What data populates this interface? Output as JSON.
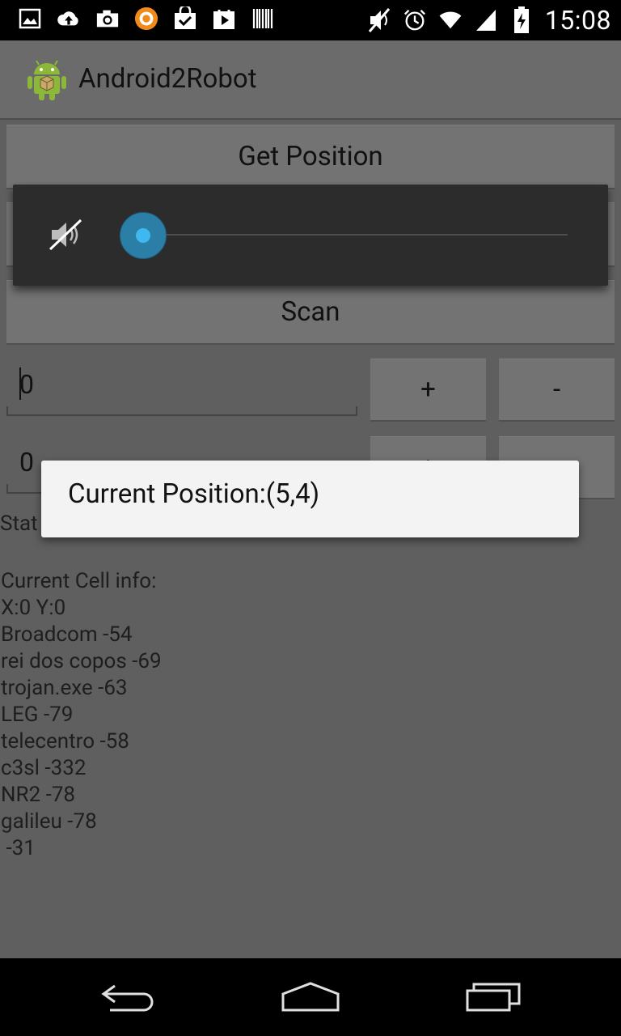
{
  "status_bar": {
    "time": "15:08",
    "left_icons": [
      "image-icon",
      "upload-icon",
      "camera-icon",
      "avast-icon",
      "shopping-bag-icon",
      "play-store-icon",
      "barcode-icon"
    ],
    "right_icons": [
      "mute-icon",
      "alarm-icon",
      "wifi-icon",
      "cell-signal-icon",
      "battery-charging-icon"
    ]
  },
  "app": {
    "title": "Android2Robot"
  },
  "buttons": {
    "get_position": "Get Position",
    "scan": "Scan",
    "plus": "+",
    "minus": "-"
  },
  "inputs": {
    "x_value": "0",
    "y_value": "0"
  },
  "status_label": "Stat",
  "cell_info": "Current Cell info:\nX:0 Y:0\nBroadcom -54\nrei dos copos -69\ntrojan.exe -63\nLEG -79\ntelecentro -58\nc3sl -332\nNR2 -78\ngalileu -78\n -31",
  "volume_panel": {
    "level": 0,
    "muted": true
  },
  "toast": {
    "message": "Current Position:(5,4)"
  },
  "nav": [
    "back-icon",
    "home-icon",
    "recents-icon"
  ],
  "colors": {
    "accent": "#3fb8ef",
    "background": "#5f5f5f"
  }
}
